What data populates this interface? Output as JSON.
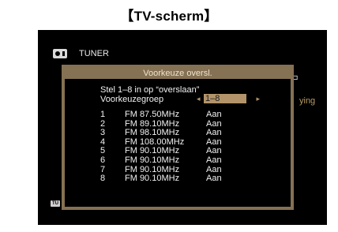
{
  "header": {
    "title": "【TV-scherm】"
  },
  "source": {
    "icon": "tuner-icon",
    "title": "TUNER"
  },
  "background": {
    "status_text": "ying",
    "side_icon": "⊐",
    "badge": "TU"
  },
  "dialog": {
    "title": "Voorkeuze oversl.",
    "instruction": "Stel 1–8 in op “overslaan”",
    "group_label": "Voorkeuzegroep",
    "group_value": "1–8",
    "arrow_left": "◂",
    "arrow_right": "▸",
    "presets": [
      {
        "num": "1",
        "freq": "FM 87.50MHz",
        "state": "Aan"
      },
      {
        "num": "2",
        "freq": "FM 89.10MHz",
        "state": "Aan"
      },
      {
        "num": "3",
        "freq": "FM 98.10MHz",
        "state": "Aan"
      },
      {
        "num": "4",
        "freq": "FM 108.00MHz",
        "state": "Aan"
      },
      {
        "num": "5",
        "freq": "FM 90.10MHz",
        "state": "Aan"
      },
      {
        "num": "6",
        "freq": "FM 90.10MHz",
        "state": "Aan"
      },
      {
        "num": "7",
        "freq": "FM 90.10MHz",
        "state": "Aan"
      },
      {
        "num": "8",
        "freq": "FM 90.10MHz",
        "state": "Aan"
      }
    ]
  },
  "colors": {
    "screen_bg": "#000000",
    "dialog_border": "#857153",
    "highlight": "#b3946a",
    "text": "#f1f1f1"
  }
}
